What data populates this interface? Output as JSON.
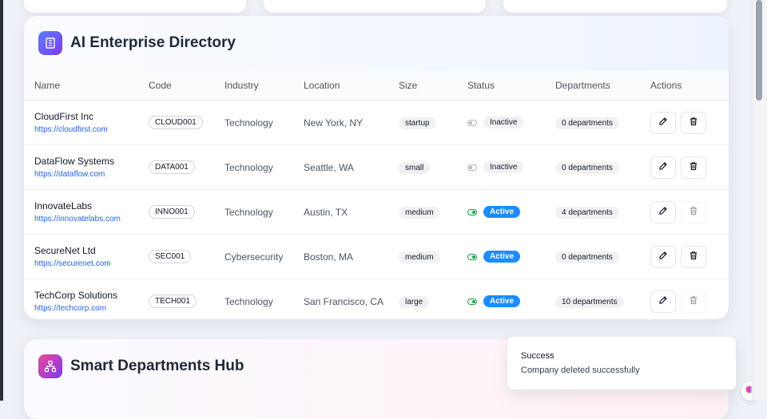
{
  "directory": {
    "title": "AI Enterprise Directory",
    "columns": [
      "Name",
      "Code",
      "Industry",
      "Location",
      "Size",
      "Status",
      "Departments",
      "Actions"
    ],
    "rows": [
      {
        "name": "CloudFirst Inc",
        "url": "https://cloudfirst.com",
        "code": "CLOUD001",
        "industry": "Technology",
        "location": "New York, NY",
        "size": "startup",
        "status": "Inactive",
        "active": false,
        "departments": "0 departments",
        "delete_enabled": true
      },
      {
        "name": "DataFlow Systems",
        "url": "https://dataflow.com",
        "code": "DATA001",
        "industry": "Technology",
        "location": "Seattle, WA",
        "size": "small",
        "status": "Inactive",
        "active": false,
        "departments": "0 departments",
        "delete_enabled": true
      },
      {
        "name": "InnovateLabs",
        "url": "https://innovatelabs.com",
        "code": "INNO001",
        "industry": "Technology",
        "location": "Austin, TX",
        "size": "medium",
        "status": "Active",
        "active": true,
        "departments": "4 departments",
        "delete_enabled": false
      },
      {
        "name": "SecureNet Ltd",
        "url": "https://securenet.com",
        "code": "SEC001",
        "industry": "Cybersecurity",
        "location": "Boston, MA",
        "size": "medium",
        "status": "Active",
        "active": true,
        "departments": "0 departments",
        "delete_enabled": true
      },
      {
        "name": "TechCorp Solutions",
        "url": "https://techcorp.com",
        "code": "TECH001",
        "industry": "Technology",
        "location": "San Francisco, CA",
        "size": "large",
        "status": "Active",
        "active": true,
        "departments": "10 departments",
        "delete_enabled": false
      }
    ]
  },
  "departments_hub": {
    "title": "Smart Departments Hub"
  },
  "toast": {
    "title": "Success",
    "message": "Company deleted successfully"
  },
  "colors": {
    "accent_blue": "#1a8cff",
    "link": "#2563eb",
    "active_toggle": "#16a34a"
  },
  "icons": {
    "directory": "building-icon",
    "departments": "org-chart-icon",
    "edit": "edit-icon",
    "delete": "trash-icon",
    "assistant": "brain-icon"
  }
}
